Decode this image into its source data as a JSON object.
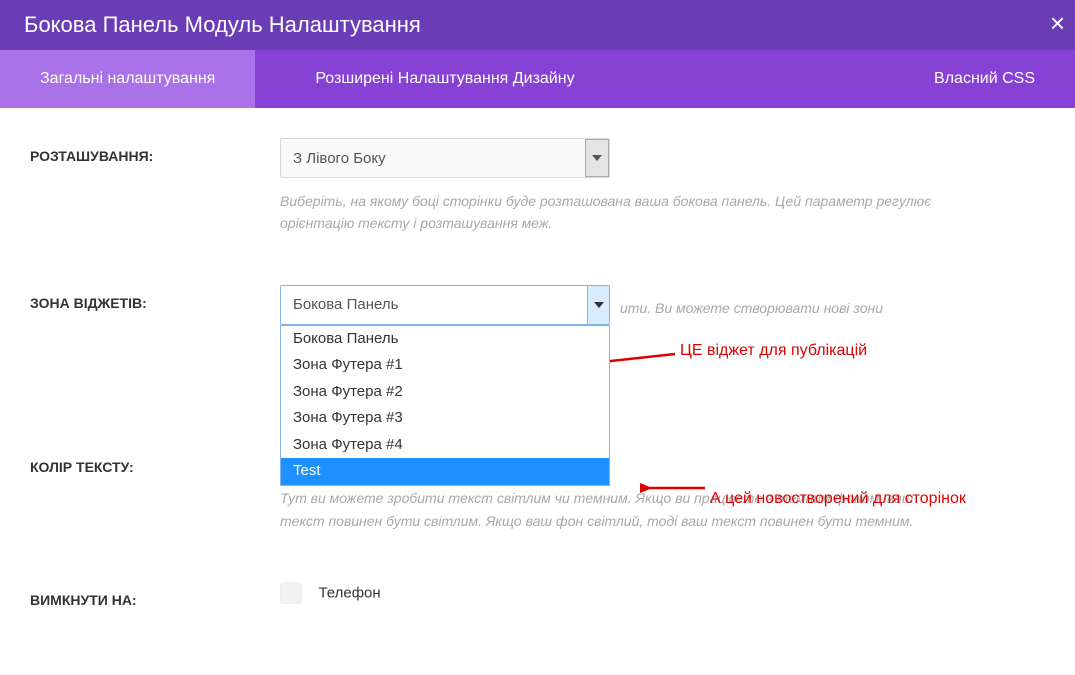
{
  "header": {
    "title": "Бокова Панель Модуль Налаштування",
    "close": "×"
  },
  "tabs": {
    "general": "Загальні налаштування",
    "design": "Розширені Налаштування Дизайну",
    "css": "Власний CSS"
  },
  "placement": {
    "label": "РОЗТАШУВАННЯ:",
    "value": "З Лівого Боку",
    "helper": "Виберіть, на якому боці сторінки буде розташована ваша бокова панель. Цей параметр регулює орієнтацію тексту і розташування меж."
  },
  "widget": {
    "label": "ЗОНА ВІДЖЕТІВ:",
    "value": "Бокова Панель",
    "helper_tail": "ити. Ви можете створювати нові зони",
    "options": {
      "o0": "Бокова Панель",
      "o1": "Зона Футера #1",
      "o2": "Зона Футера #2",
      "o3": "Зона Футера #3",
      "o4": "Зона Футера #4",
      "o5": "Test"
    }
  },
  "textcolor": {
    "label": "КОЛІР ТЕКСТУ:",
    "helper": "Тут ви можете зробити текст світлим чи темним. Якщо ви працюєте з темним фоном, ваш текст повинен бути світлим. Якщо ваш фон світлий, тоді ваш текст повинен бути темним."
  },
  "disable": {
    "label": "ВИМКНУТИ НА:",
    "phone": "Телефон"
  },
  "annotations": {
    "a1": "ЦЕ віджет для публікацій",
    "a2": "А цей новостворений для сторінок"
  }
}
